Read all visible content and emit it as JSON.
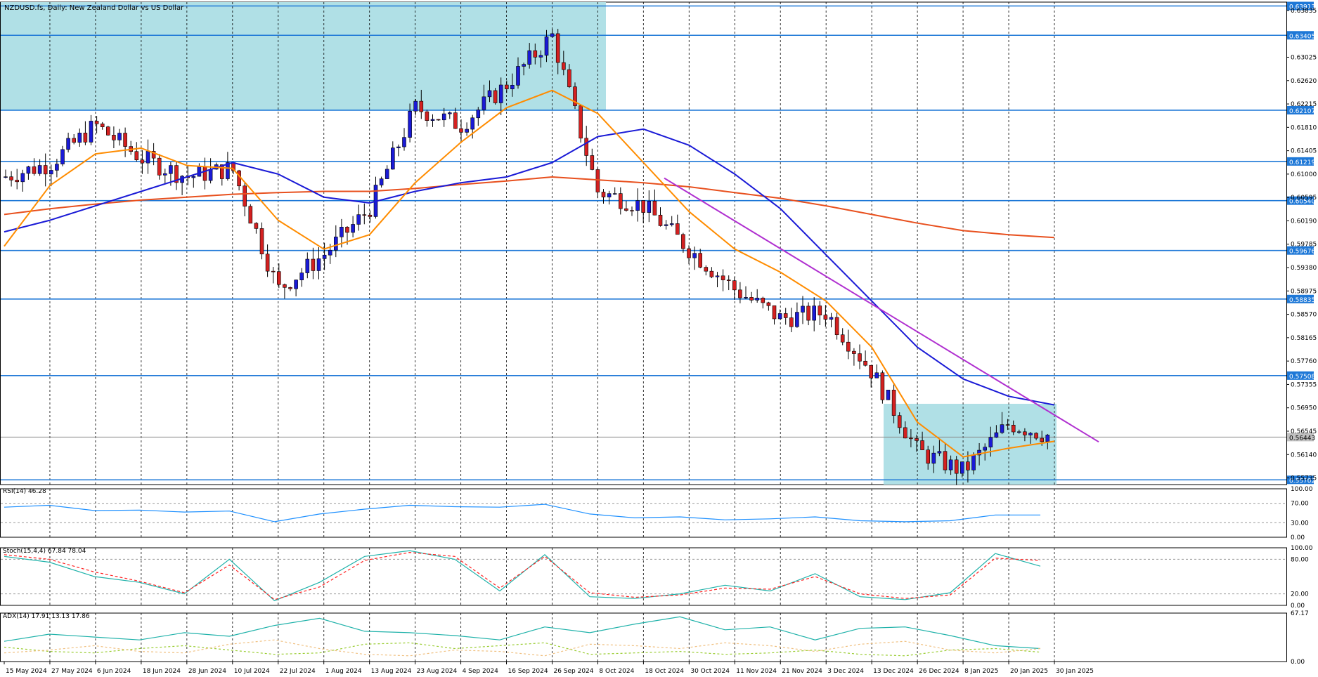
{
  "window": {
    "symbol_title": "NZDUSD.fs, Daily:  New Zealand Dollar vs US Dollar"
  },
  "panels": {
    "rsi": {
      "label": "RSI(14) 46.28",
      "levels": [
        "100.00",
        "70.00",
        "30.00",
        "0.00"
      ]
    },
    "stoch": {
      "label": "Stoch(15,4,4) 67.84 78.04",
      "levels": [
        "100.00",
        "80.00",
        "20.00",
        "0.00"
      ]
    },
    "adx": {
      "label": "ADX(14) 17.91 13.13 17.86",
      "levels": [
        "67.17",
        "0.00"
      ]
    }
  },
  "colors": {
    "bull_candle": "#1a1ad6",
    "bear_candle": "#d42020",
    "zone_fill": "#b0e0e6",
    "hline": "#1e78d7",
    "ma_fast": "#ff8c00",
    "ma_mid": "#1a1ad6",
    "ma_slow": "#e8501e",
    "trendline": "#b030d0",
    "rsi_line": "#1e90ff",
    "stoch_main": "#20b2aa",
    "stoch_signal": "#ff2020",
    "adx_main": "#20b2aa",
    "adx_plus": "#9acd32",
    "adx_minus": "#f0c080"
  },
  "chart_data": {
    "type": "candlestick",
    "title": "NZDUSD.fs, Daily:  New Zealand Dollar vs US Dollar",
    "y_range": [
      0.5562,
      0.6398
    ],
    "y_ticks": [
      "0.63835",
      "0.63025",
      "0.62620",
      "0.62215",
      "0.61810",
      "0.61405",
      "0.61000",
      "0.60595",
      "0.60190",
      "0.59785",
      "0.59380",
      "0.58975",
      "0.58570",
      "0.58165",
      "0.57760",
      "0.57355",
      "0.56950",
      "0.56545",
      "0.56140",
      "0.55735"
    ],
    "horizontal_levels": [
      "0.63913",
      "0.63405",
      "0.62107",
      "0.61219",
      "0.60540",
      "0.59676",
      "0.58835",
      "0.57508",
      "0.55702"
    ],
    "current_price": "0.56443",
    "x_dates": [
      "15 May 2024",
      "27 May 2024",
      "6 Jun 2024",
      "18 Jun 2024",
      "28 Jun 2024",
      "10 Jul 2024",
      "22 Jul 2024",
      "1 Aug 2024",
      "13 Aug 2024",
      "23 Aug 2024",
      "4 Sep 2024",
      "16 Sep 2024",
      "26 Sep 2024",
      "8 Oct 2024",
      "18 Oct 2024",
      "30 Oct 2024",
      "11 Nov 2024",
      "21 Nov 2024",
      "3 Dec 2024",
      "13 Dec 2024",
      "26 Dec 2024",
      "8 Jan 2025",
      "20 Jan 2025",
      "30 Jan 2025"
    ],
    "zones": [
      {
        "from": "15 May 2024",
        "to": "8 Oct 2024",
        "low": 0.62107,
        "high": 0.6398
      },
      {
        "from": "13 Dec 2024",
        "to": "30 Jan 2025",
        "low": 0.5562,
        "high": 0.5702
      }
    ],
    "trendline": {
      "from": {
        "date": "18 Oct 2024",
        "price": 0.6093
      },
      "to": {
        "date": "30 Jan 2025 +",
        "price": 0.5636
      }
    },
    "close_path": [
      [
        "15 May 2024",
        0.6095
      ],
      [
        "27 May 2024",
        0.6118
      ],
      [
        "6 Jun 2024",
        0.6185
      ],
      [
        "18 Jun 2024",
        0.6128
      ],
      [
        "28 Jun 2024",
        0.6095
      ],
      [
        "10 Jul 2024",
        0.611
      ],
      [
        "22 Jul 2024",
        0.59
      ],
      [
        "1 Aug 2024",
        0.596
      ],
      [
        "13 Aug 2024",
        0.604
      ],
      [
        "23 Aug 2024",
        0.6215
      ],
      [
        "4 Sep 2024",
        0.6185
      ],
      [
        "16 Sep 2024",
        0.6255
      ],
      [
        "26 Sep 2024",
        0.634
      ],
      [
        "8 Oct 2024",
        0.607
      ],
      [
        "18 Oct 2024",
        0.6045
      ],
      [
        "30 Oct 2024",
        0.597
      ],
      [
        "11 Nov 2024",
        0.59
      ],
      [
        "21 Nov 2024",
        0.585
      ],
      [
        "3 Dec 2024",
        0.586
      ],
      [
        "13 Dec 2024",
        0.5758
      ],
      [
        "26 Dec 2024",
        0.562
      ],
      [
        "8 Jan 2025",
        0.5585
      ],
      [
        "20 Jan 2025",
        0.5668
      ],
      [
        "30 Jan 2025",
        0.5644
      ]
    ],
    "ma_fast": [
      [
        "15 May 2024",
        0.5975
      ],
      [
        "27 May 2024",
        0.608
      ],
      [
        "6 Jun 2024",
        0.6135
      ],
      [
        "18 Jun 2024",
        0.6145
      ],
      [
        "28 Jun 2024",
        0.6115
      ],
      [
        "10 Jul 2024",
        0.611
      ],
      [
        "22 Jul 2024",
        0.602
      ],
      [
        "1 Aug 2024",
        0.597
      ],
      [
        "13 Aug 2024",
        0.5995
      ],
      [
        "23 Aug 2024",
        0.6085
      ],
      [
        "4 Sep 2024",
        0.6155
      ],
      [
        "16 Sep 2024",
        0.6215
      ],
      [
        "26 Sep 2024",
        0.6245
      ],
      [
        "8 Oct 2024",
        0.6205
      ],
      [
        "18 Oct 2024",
        0.612
      ],
      [
        "30 Oct 2024",
        0.6035
      ],
      [
        "11 Nov 2024",
        0.597
      ],
      [
        "21 Nov 2024",
        0.593
      ],
      [
        "3 Dec 2024",
        0.588
      ],
      [
        "13 Dec 2024",
        0.58
      ],
      [
        "26 Dec 2024",
        0.567
      ],
      [
        "8 Jan 2025",
        0.561
      ],
      [
        "20 Jan 2025",
        0.5625
      ],
      [
        "30 Jan 2025",
        0.5637
      ]
    ],
    "ma_mid": [
      [
        "15 May 2024",
        0.6
      ],
      [
        "27 May 2024",
        0.602
      ],
      [
        "6 Jun 2024",
        0.6045
      ],
      [
        "18 Jun 2024",
        0.607
      ],
      [
        "28 Jun 2024",
        0.6095
      ],
      [
        "10 Jul 2024",
        0.612
      ],
      [
        "22 Jul 2024",
        0.61
      ],
      [
        "1 Aug 2024",
        0.606
      ],
      [
        "13 Aug 2024",
        0.605
      ],
      [
        "23 Aug 2024",
        0.607
      ],
      [
        "4 Sep 2024",
        0.6085
      ],
      [
        "16 Sep 2024",
        0.6095
      ],
      [
        "26 Sep 2024",
        0.612
      ],
      [
        "8 Oct 2024",
        0.6165
      ],
      [
        "18 Oct 2024",
        0.6178
      ],
      [
        "30 Oct 2024",
        0.615
      ],
      [
        "11 Nov 2024",
        0.61
      ],
      [
        "21 Nov 2024",
        0.604
      ],
      [
        "3 Dec 2024",
        0.596
      ],
      [
        "13 Dec 2024",
        0.588
      ],
      [
        "26 Dec 2024",
        0.58
      ],
      [
        "8 Jan 2025",
        0.5745
      ],
      [
        "20 Jan 2025",
        0.5715
      ],
      [
        "30 Jan 2025",
        0.57
      ]
    ],
    "ma_slow": [
      [
        "15 May 2024",
        0.603
      ],
      [
        "27 May 2024",
        0.604
      ],
      [
        "6 Jun 2024",
        0.6048
      ],
      [
        "18 Jun 2024",
        0.6055
      ],
      [
        "28 Jun 2024",
        0.606
      ],
      [
        "10 Jul 2024",
        0.6065
      ],
      [
        "22 Jul 2024",
        0.6068
      ],
      [
        "1 Aug 2024",
        0.607
      ],
      [
        "13 Aug 2024",
        0.607
      ],
      [
        "23 Aug 2024",
        0.6075
      ],
      [
        "4 Sep 2024",
        0.6082
      ],
      [
        "16 Sep 2024",
        0.6088
      ],
      [
        "26 Sep 2024",
        0.6095
      ],
      [
        "8 Oct 2024",
        0.609
      ],
      [
        "18 Oct 2024",
        0.6085
      ],
      [
        "30 Oct 2024",
        0.6078
      ],
      [
        "11 Nov 2024",
        0.6068
      ],
      [
        "21 Nov 2024",
        0.6058
      ],
      [
        "3 Dec 2024",
        0.6045
      ],
      [
        "13 Dec 2024",
        0.603
      ],
      [
        "26 Dec 2024",
        0.6015
      ],
      [
        "8 Jan 2025",
        0.6002
      ],
      [
        "20 Jan 2025",
        0.5995
      ],
      [
        "30 Jan 2025",
        0.599
      ]
    ],
    "rsi_values": [
      62,
      66,
      55,
      56,
      52,
      54,
      32,
      48,
      58,
      66,
      63,
      62,
      68,
      48,
      40,
      42,
      36,
      38,
      42,
      34,
      32,
      34,
      46,
      46
    ],
    "stoch_main": [
      85,
      75,
      50,
      40,
      20,
      80,
      8,
      40,
      85,
      95,
      80,
      25,
      88,
      15,
      12,
      20,
      35,
      25,
      55,
      15,
      10,
      22,
      90,
      68
    ],
    "stoch_signal": [
      88,
      80,
      58,
      42,
      22,
      70,
      10,
      32,
      78,
      92,
      85,
      30,
      85,
      22,
      14,
      18,
      30,
      28,
      50,
      20,
      12,
      18,
      82,
      78
    ],
    "adx_main": [
      28,
      38,
      34,
      30,
      40,
      35,
      50,
      60,
      42,
      40,
      36,
      30,
      48,
      40,
      52,
      62,
      44,
      48,
      30,
      46,
      48,
      36,
      22,
      18
    ],
    "adx_plus": [
      20,
      14,
      12,
      18,
      22,
      16,
      10,
      12,
      24,
      26,
      18,
      22,
      26,
      10,
      12,
      14,
      10,
      12,
      16,
      10,
      8,
      16,
      18,
      13
    ],
    "adx_minus": [
      12,
      16,
      22,
      14,
      12,
      24,
      30,
      18,
      10,
      8,
      16,
      14,
      8,
      24,
      22,
      18,
      26,
      22,
      14,
      24,
      28,
      16,
      12,
      18
    ]
  }
}
